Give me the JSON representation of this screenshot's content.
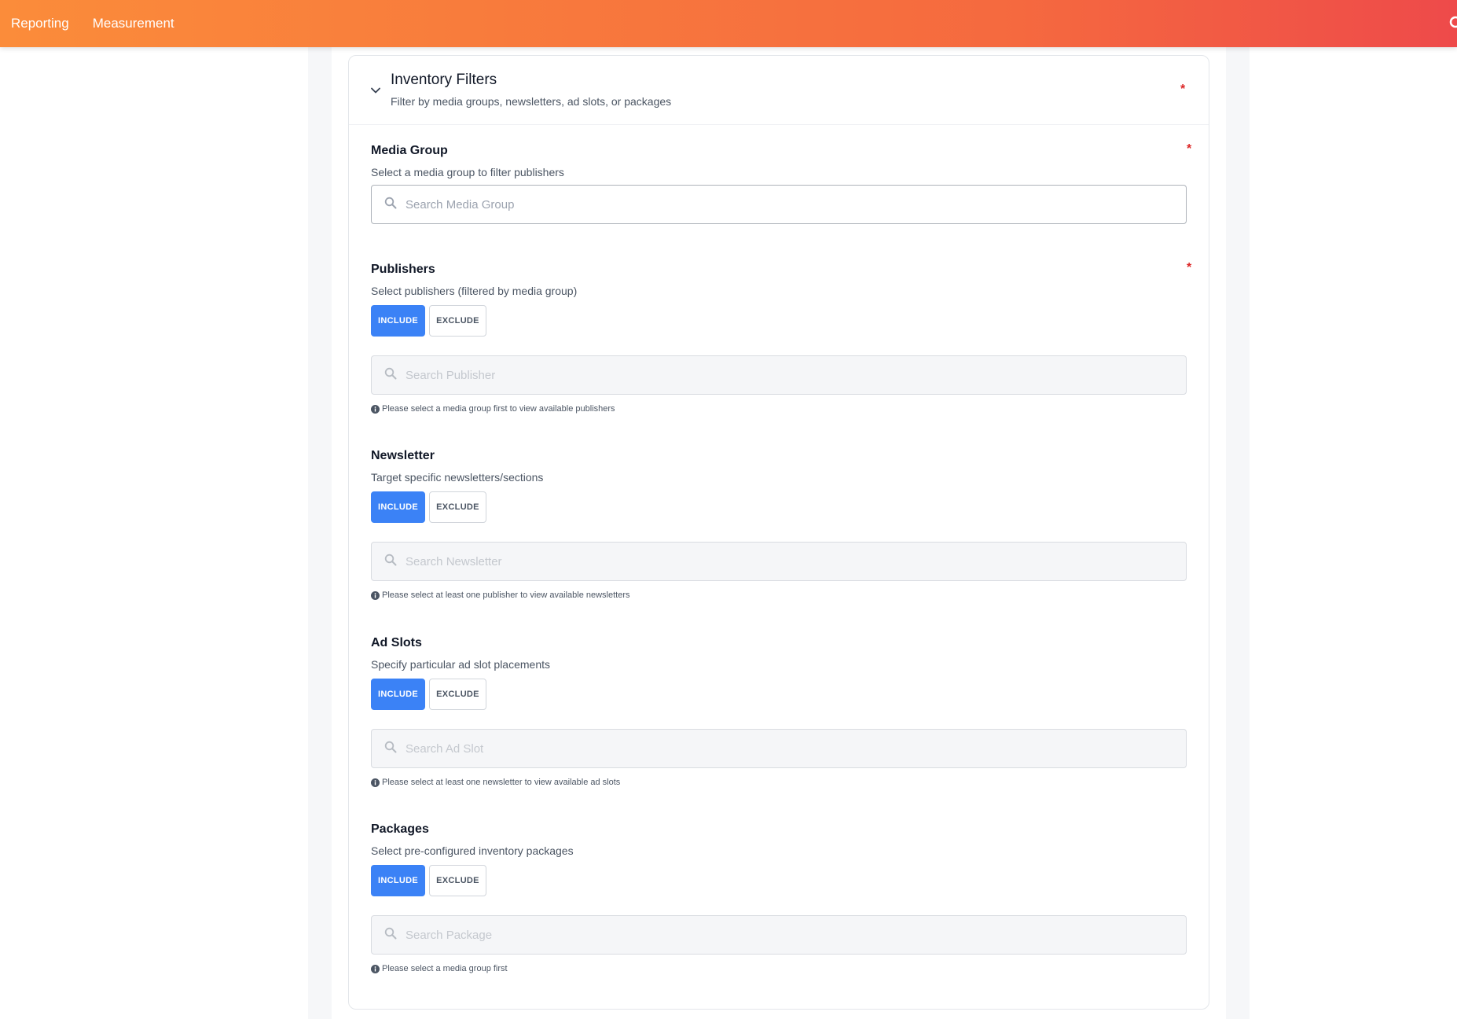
{
  "nav": {
    "items": [
      "Reporting",
      "Measurement"
    ]
  },
  "filters": {
    "title": "Inventory Filters",
    "subtitle": "Filter by media groups, newsletters, ad slots, or packages",
    "required_mark": "*"
  },
  "media_group": {
    "title": "Media Group",
    "subtitle": "Select a media group to filter publishers",
    "placeholder": "Search Media Group",
    "required_mark": "*"
  },
  "publishers": {
    "title": "Publishers",
    "subtitle": "Select publishers (filtered by media group)",
    "include": "INCLUDE",
    "exclude": "EXCLUDE",
    "placeholder": "Search Publisher",
    "hint": "Please select a media group first to view available publishers",
    "required_mark": "*"
  },
  "newsletter": {
    "title": "Newsletter",
    "subtitle": "Target specific newsletters/sections",
    "include": "INCLUDE",
    "exclude": "EXCLUDE",
    "placeholder": "Search Newsletter",
    "hint": "Please select at least one publisher to view available newsletters"
  },
  "ad_slots": {
    "title": "Ad Slots",
    "subtitle": "Specify particular ad slot placements",
    "include": "INCLUDE",
    "exclude": "EXCLUDE",
    "placeholder": "Search Ad Slot",
    "hint": "Please select at least one newsletter to view available ad slots"
  },
  "packages": {
    "title": "Packages",
    "subtitle": "Select pre-configured inventory packages",
    "include": "INCLUDE",
    "exclude": "EXCLUDE",
    "placeholder": "Search Package",
    "hint": "Please select a media group first"
  },
  "theme": {
    "accent": "#3b82f6",
    "required": "#dc2626",
    "header_gradient_start": "#fb8c3a",
    "header_gradient_end": "#ee4a4a"
  },
  "icons": [
    "chevron-down-icon",
    "search-icon",
    "info-icon"
  ]
}
